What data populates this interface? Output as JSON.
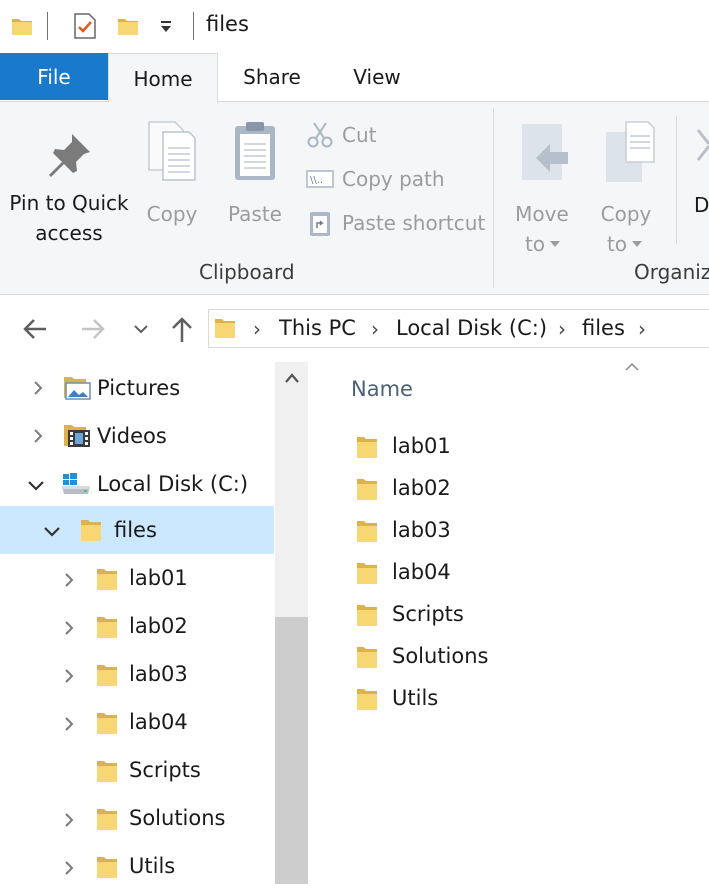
{
  "window": {
    "title": "files",
    "quick_access_icons": [
      "folder-icon",
      "properties-checkmark-icon",
      "new-folder-icon",
      "customize-dropdown-icon"
    ]
  },
  "tabs": [
    {
      "label": "File",
      "active": false
    },
    {
      "label": "Home",
      "active": true
    },
    {
      "label": "Share",
      "active": false
    },
    {
      "label": "View",
      "active": false
    }
  ],
  "ribbon": {
    "pin": {
      "label_line1": "Pin to Quick",
      "label_line2": "access"
    },
    "copy": "Copy",
    "paste": "Paste",
    "cut": "Cut",
    "copy_path": "Copy path",
    "paste_shortcut": "Paste shortcut",
    "clipboard_group": "Clipboard",
    "move_to": {
      "line1": "Move",
      "line2": "to"
    },
    "copy_to": {
      "line1": "Copy",
      "line2": "to"
    },
    "partial_next": "D",
    "organize_group": "Organiz"
  },
  "address": {
    "breadcrumbs": [
      "This PC",
      "Local Disk (C:)",
      "files"
    ]
  },
  "tree": [
    {
      "label": "Pictures",
      "icon": "pictures-folder-icon",
      "expand": "collapsed",
      "selected": false
    },
    {
      "label": "Videos",
      "icon": "videos-folder-icon",
      "expand": "collapsed",
      "selected": false
    },
    {
      "label": "Local Disk (C:)",
      "icon": "local-disk-icon",
      "expand": "expanded",
      "selected": false
    },
    {
      "label": "files",
      "icon": "folder-icon",
      "expand": "expanded",
      "selected": true
    },
    {
      "label": "lab01",
      "icon": "folder-icon",
      "expand": "collapsed",
      "selected": false
    },
    {
      "label": "lab02",
      "icon": "folder-icon",
      "expand": "collapsed",
      "selected": false
    },
    {
      "label": "lab03",
      "icon": "folder-icon",
      "expand": "collapsed",
      "selected": false
    },
    {
      "label": "lab04",
      "icon": "folder-icon",
      "expand": "collapsed",
      "selected": false
    },
    {
      "label": "Scripts",
      "icon": "folder-icon",
      "expand": "none",
      "selected": false
    },
    {
      "label": "Solutions",
      "icon": "folder-icon",
      "expand": "collapsed",
      "selected": false
    },
    {
      "label": "Utils",
      "icon": "folder-icon",
      "expand": "collapsed",
      "selected": false
    }
  ],
  "content": {
    "column_header": "Name",
    "items": [
      "lab01",
      "lab02",
      "lab03",
      "lab04",
      "Scripts",
      "Solutions",
      "Utils"
    ]
  },
  "colors": {
    "file_tab": "#1979ca",
    "selection": "#cce8ff",
    "folder": "#f7d674"
  }
}
